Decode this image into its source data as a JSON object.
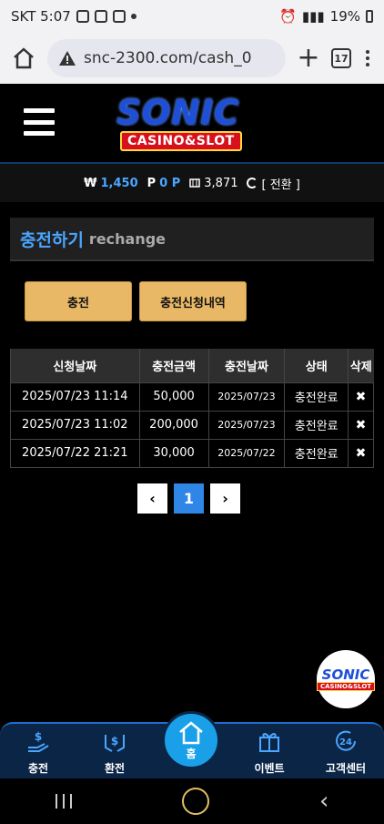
{
  "status_bar": {
    "carrier_time": "SKT 5:07",
    "battery": "19%"
  },
  "browser": {
    "url": "snc-2300.com/cash_0",
    "tab_count": "17"
  },
  "logo": {
    "main": "SONIC",
    "sub": "CASINO&SLOT"
  },
  "balance": {
    "won_symbol": "₩",
    "won_value": "1,450",
    "point_symbol": "P",
    "point_value": "0 P",
    "chip_value": "3,871",
    "exchange_label": "[ 전환 ]"
  },
  "page_title": {
    "korean": "충전하기",
    "english": "rechange"
  },
  "buttons": {
    "charge": "충전",
    "history": "충전신청내역"
  },
  "table": {
    "headers": [
      "신청날짜",
      "충전금액",
      "충전날짜",
      "상태",
      "삭제"
    ],
    "rows": [
      {
        "request_date": "2025/07/23 11:14",
        "amount": "50,000",
        "charge_date": "2025/07/23",
        "status": "충전완료",
        "delete": "✖"
      },
      {
        "request_date": "2025/07/23 11:02",
        "amount": "200,000",
        "charge_date": "2025/07/23",
        "status": "충전완료",
        "delete": "✖"
      },
      {
        "request_date": "2025/07/22 21:21",
        "amount": "30,000",
        "charge_date": "2025/07/22",
        "status": "충전완료",
        "delete": "✖"
      }
    ]
  },
  "pagination": {
    "prev": "‹",
    "current": "1",
    "next": "›"
  },
  "float_logo": {
    "main": "SONIC",
    "sub": "CASINO&SLOT"
  },
  "bottom_nav": {
    "charge": "충전",
    "exchange": "환전",
    "home": "홈",
    "event": "이벤트",
    "support": "고객센터"
  },
  "colors": {
    "accent_blue": "#4aa6ff",
    "button_gold": "#e8b866",
    "nav_bg": "#0b2547",
    "home_circle": "#1aa0e8"
  }
}
